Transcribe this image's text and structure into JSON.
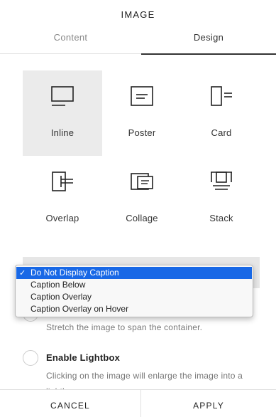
{
  "panel": {
    "title": "IMAGE"
  },
  "tabs": [
    {
      "label": "Content",
      "active": false
    },
    {
      "label": "Design",
      "active": true
    }
  ],
  "layouts": [
    {
      "label": "Inline",
      "icon": "inline-layout-icon",
      "selected": true
    },
    {
      "label": "Poster",
      "icon": "poster-layout-icon",
      "selected": false
    },
    {
      "label": "Card",
      "icon": "card-layout-icon",
      "selected": false
    },
    {
      "label": "Overlap",
      "icon": "overlap-layout-icon",
      "selected": false
    },
    {
      "label": "Collage",
      "icon": "collage-layout-icon",
      "selected": false
    },
    {
      "label": "Stack",
      "icon": "stack-layout-icon",
      "selected": false
    }
  ],
  "caption_select": {
    "selected": "Do Not Display Caption",
    "options": [
      "Do Not Display Caption",
      "Caption Below",
      "Caption Overlay",
      "Caption Overlay on Hover"
    ]
  },
  "stretch": {
    "description": "Stretch the image to span the container."
  },
  "lightbox": {
    "label": "Enable Lightbox",
    "description": "Clicking on the image will enlarge the image into a lightbox.",
    "checked": false
  },
  "footer": {
    "cancel_label": "CANCEL",
    "apply_label": "APPLY"
  },
  "colors": {
    "selection_blue": "#1868e6",
    "selected_card_bg": "#ebebeb"
  }
}
